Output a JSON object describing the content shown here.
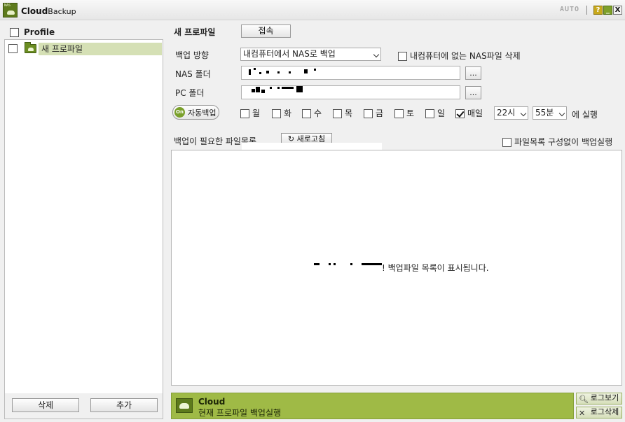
{
  "titlebar": {
    "logo_text": "NAS",
    "title_main": "Cloud",
    "title_sub": "Backup",
    "auto_label": "AUTO",
    "help_button": "?",
    "minimize_button": "_",
    "close_button": "X"
  },
  "profiles": {
    "header_label": "Profile",
    "items": [
      {
        "label": "새 프로파일",
        "selected": true
      }
    ],
    "delete_button": "삭제",
    "add_button": "추가"
  },
  "main": {
    "profile_name": "새 프로파일",
    "connect_button": "접속",
    "direction_label": "백업 방향",
    "direction_value": "내컴퓨터에서 NAS로 백업",
    "delete_missing_label": "내컴퓨터에 없는 NAS파일 삭제",
    "nas_folder_label": "NAS 폴더",
    "pc_folder_label": "PC 폴더",
    "browse_button": "...",
    "auto_backup": {
      "knob": "On",
      "label": "자동백업"
    },
    "days": [
      {
        "label": "월",
        "checked": false
      },
      {
        "label": "화",
        "checked": false
      },
      {
        "label": "수",
        "checked": false
      },
      {
        "label": "목",
        "checked": false
      },
      {
        "label": "금",
        "checked": false
      },
      {
        "label": "토",
        "checked": false
      },
      {
        "label": "일",
        "checked": false
      },
      {
        "label": "매일",
        "checked": true
      }
    ],
    "hour_value": "22시",
    "minute_value": "55분",
    "run_suffix": "에 실행",
    "file_list_label": "백업이 필요한 파일목록",
    "refresh_button": "새로고침",
    "skip_list_label": "파일목록 구성없이 백업실행",
    "file_list_message": "! 백업파일 목록이 표시됩니다."
  },
  "status": {
    "title": "Cloud",
    "message": "현재 프로파일 백업실행",
    "view_log_button": "로그보기",
    "delete_log_button": "로그삭제"
  },
  "colors": {
    "accent_green": "#9fba46",
    "selection_bg": "#d5e0b5",
    "logo_green": "#5d7a1c"
  }
}
